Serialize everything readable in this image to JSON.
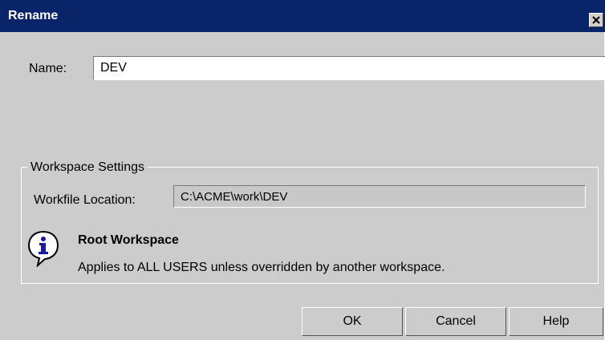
{
  "dialog": {
    "title": "Rename",
    "close_glyph": "✕",
    "close_icon": "close-icon"
  },
  "name_field": {
    "label": "Name:",
    "value": "DEV"
  },
  "workspace_settings": {
    "group_title": "Workspace Settings",
    "workfile_label": "Workfile Location:",
    "workfile_value": "C:\\ACME\\work\\DEV",
    "info_icon": "info-icon",
    "root_title": "Root Workspace",
    "root_description": "Applies to ALL USERS unless overridden by another workspace."
  },
  "buttons": {
    "ok": "OK",
    "cancel": "Cancel",
    "help": "Help"
  },
  "colors": {
    "titlebar": "#0a246a",
    "dialog_bg": "#cccccc"
  }
}
